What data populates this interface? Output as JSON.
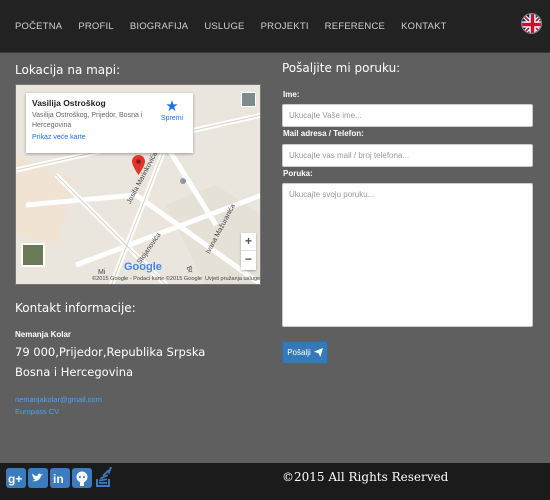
{
  "nav": {
    "items": [
      "POČETNA",
      "PROFIL",
      "BIOGRAFIJA",
      "USLUGE",
      "PROJEKTI",
      "REFERENCE",
      "KONTAKT"
    ],
    "flag_icon": "uk-flag-icon"
  },
  "map_section": {
    "title": "Lokacija na mapi:",
    "card": {
      "place": "Vasilija Ostroškog",
      "address": "Vasilija Ostroškog, Prijedor, Bosna i Hercegovina",
      "bigger_map": "Prikaz veće karte",
      "save": "Spremi"
    },
    "roads": [
      "Josifa Marinkovića",
      "Ivana Mažuranića",
      "Stojanovića",
      "Mi",
      "Br"
    ],
    "google": "Google",
    "copyright": "©2015 Google - Podaci karte ©2015 Google",
    "terms": "Uvjeti pružanja usluge",
    "zoom_in": "+",
    "zoom_out": "−"
  },
  "contact": {
    "title": "Kontakt informacije:",
    "name": "Nemanja Kolar",
    "city": "79 000,Prijedor,Republika Srpska",
    "country": "Bosna i Hercegovina",
    "email": "nemanjakolar@gmail.com",
    "cv": "Europass CV"
  },
  "form": {
    "title": "Pošaljite mi poruku:",
    "name_label": "Ime:",
    "name_placeholder": "Ukucajte Vaše ime...",
    "mail_label": "Mail adresa / Telefon:",
    "mail_placeholder": "Ukucajte vas mail / broj telefona...",
    "message_label": "Poruka:",
    "message_placeholder": "Ukucajte svoju poruku...",
    "send_label": "Pošalji"
  },
  "footer": {
    "social_icons": [
      "google-plus-icon",
      "twitter-icon",
      "linkedin-icon",
      "github-icon",
      "stackoverflow-icon"
    ],
    "copyright": "©2015 All Rights Reserved"
  },
  "colors": {
    "background": "#5f5f5f",
    "navbar": "#222222",
    "footer": "#1b1b1b",
    "link": "#4aa3ff",
    "button": "#337ab7",
    "social": "#3b7bbf"
  }
}
